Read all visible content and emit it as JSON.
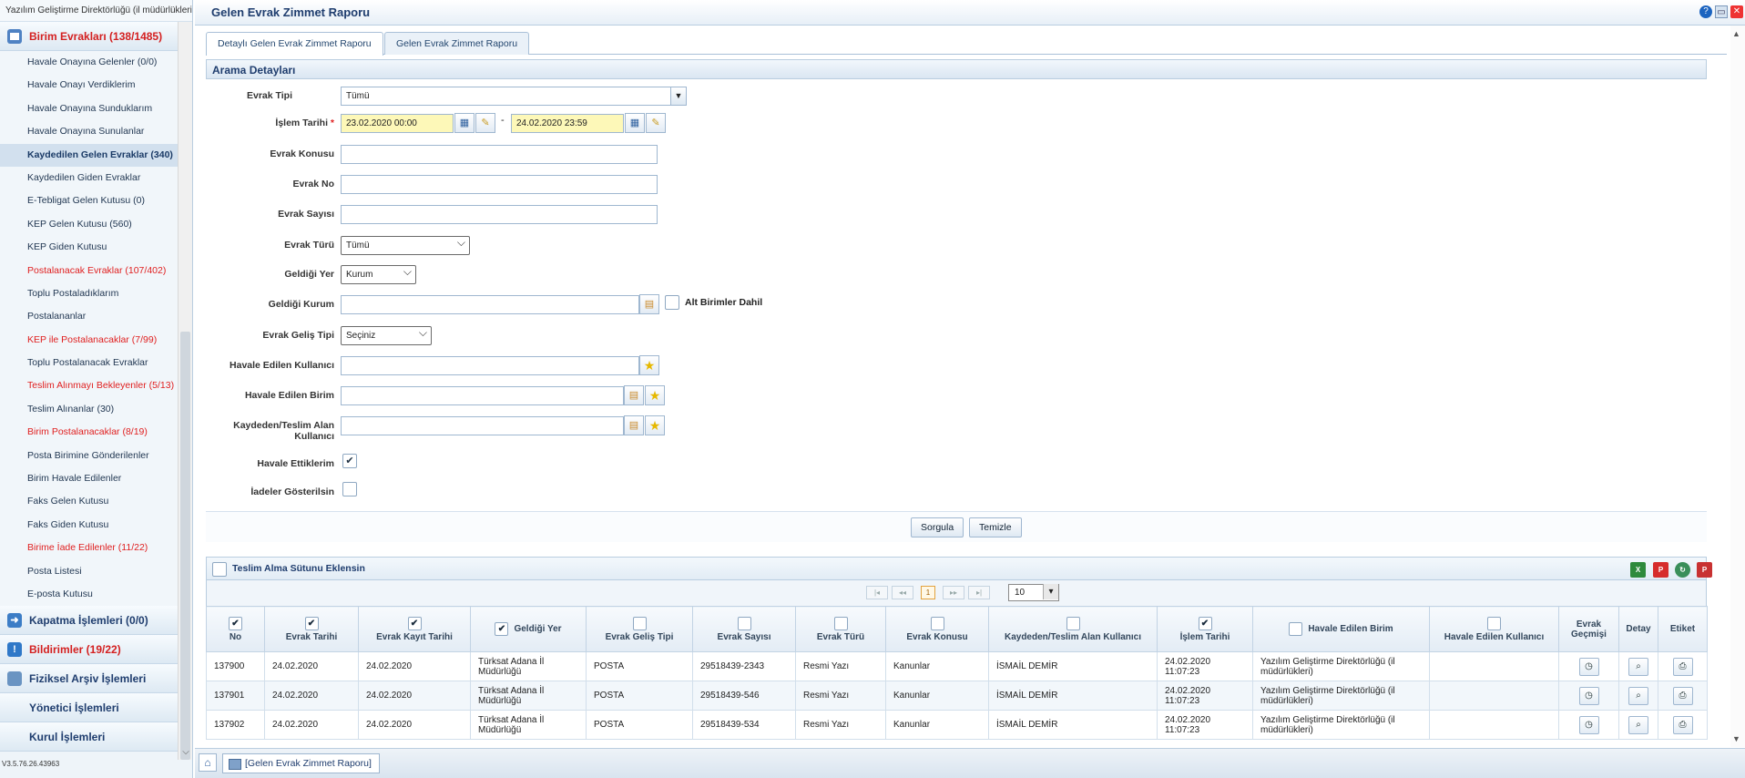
{
  "sidebar": {
    "header": "Yazılım Geliştirme Direktörlüğü (il müdürlükleri)",
    "version": "V3.5.76.26.43963",
    "section_main": "Birim Evrakları (138/1485)",
    "items": [
      {
        "label": "Havale Onayına Gelenler (0/0)",
        "red": false
      },
      {
        "label": "Havale Onayı Verdiklerim",
        "red": false
      },
      {
        "label": "Havale Onayına Sunduklarım",
        "red": false
      },
      {
        "label": "Havale Onayına Sunulanlar",
        "red": false
      },
      {
        "label": "Kaydedilen Gelen Evraklar (340)",
        "red": false,
        "active": true
      },
      {
        "label": "Kaydedilen Giden Evraklar",
        "red": false
      },
      {
        "label": "E-Tebligat Gelen Kutusu (0)",
        "red": false
      },
      {
        "label": "KEP Gelen Kutusu (560)",
        "red": false
      },
      {
        "label": "KEP Giden Kutusu",
        "red": false
      },
      {
        "label": "Postalanacak Evraklar (107/402)",
        "red": true
      },
      {
        "label": "Toplu Postaladıklarım",
        "red": false
      },
      {
        "label": "Postalananlar",
        "red": false
      },
      {
        "label": "KEP ile Postalanacaklar (7/99)",
        "red": true
      },
      {
        "label": "Toplu Postalanacak Evraklar",
        "red": false
      },
      {
        "label": "Teslim Alınmayı Bekleyenler (5/13)",
        "red": true
      },
      {
        "label": "Teslim Alınanlar (30)",
        "red": false
      },
      {
        "label": "Birim Postalanacaklar (8/19)",
        "red": true
      },
      {
        "label": "Posta Birimine Gönderilenler",
        "red": false
      },
      {
        "label": "Birim Havale Edilenler",
        "red": false
      },
      {
        "label": "Faks Gelen Kutusu",
        "red": false
      },
      {
        "label": "Faks Giden Kutusu",
        "red": false
      },
      {
        "label": "Birime İade Edilenler (11/22)",
        "red": true
      },
      {
        "label": "Posta Listesi",
        "red": false
      },
      {
        "label": "E-posta Kutusu",
        "red": false
      }
    ],
    "section_kapatma": "Kapatma İşlemleri (0/0)",
    "section_bildirimler": "Bildirimler (19/22)",
    "section_arsiv": "Fiziksel Arşiv İşlemleri",
    "section_yonetici": "Yönetici İşlemleri",
    "section_kurul": "Kurul İşlemleri"
  },
  "header": {
    "title": "Gelen Evrak Zimmet Raporu",
    "help": "?"
  },
  "tabs": [
    "Detaylı Gelen Evrak Zimmet Raporu",
    "Gelen Evrak Zimmet Raporu"
  ],
  "form": {
    "section_title": "Arama Detayları",
    "evrak_tipi_label": "Evrak Tipi",
    "evrak_tipi_value": "Tümü",
    "islem_tarihi_label": "İşlem Tarihi",
    "islem_tarihi_required": "*",
    "islem_tarihi_from": "23.02.2020 00:00",
    "islem_tarihi_sep": "-",
    "islem_tarihi_to": "24.02.2020 23:59",
    "evrak_konusu_label": "Evrak Konusu",
    "evrak_no_label": "Evrak No",
    "evrak_sayisi_label": "Evrak Sayısı",
    "evrak_turu_label": "Evrak Türü",
    "evrak_turu_value": "Tümü",
    "geldigi_yer_label": "Geldiği Yer",
    "geldigi_yer_value": "Kurum",
    "geldigi_kurum_label": "Geldiği Kurum",
    "alt_birimler_label": "Alt Birimler Dahil",
    "evrak_gelis_tipi_label": "Evrak Geliş Tipi",
    "evrak_gelis_tipi_value": "Seçiniz",
    "havale_edilen_kullanici_label": "Havale Edilen Kullanıcı",
    "havale_edilen_birim_label": "Havale Edilen Birim",
    "kaydeden_label": "Kaydeden/Teslim Alan Kullanıcı",
    "havale_ettiklerim_label": "Havale Ettiklerim",
    "iadeler_label": "İadeler Gösterilsin"
  },
  "actions": {
    "sorgula": "Sorgula",
    "temizle": "Temizle"
  },
  "grid": {
    "teslim_alma_label": "Teslim Alma Sütunu Eklensin",
    "pager_current": "1",
    "page_size": "10",
    "columns": [
      {
        "label": "No",
        "checked": true
      },
      {
        "label": "Evrak Tarihi",
        "checked": true
      },
      {
        "label": "Evrak Kayıt Tarihi",
        "checked": true
      },
      {
        "label": "Geldiği Yer",
        "checked": true,
        "inline": true
      },
      {
        "label": "Evrak Geliş Tipi",
        "checked": false
      },
      {
        "label": "Evrak Sayısı",
        "checked": false
      },
      {
        "label": "Evrak Türü",
        "checked": false
      },
      {
        "label": "Evrak Konusu",
        "checked": false
      },
      {
        "label": "Kaydeden/Teslim Alan Kullanıcı",
        "checked": false
      },
      {
        "label": "İşlem Tarihi",
        "checked": true
      },
      {
        "label": "Havale Edilen Birim",
        "checked": false,
        "inline": true
      },
      {
        "label": "Havale Edilen Kullanıcı",
        "checked": false
      },
      {
        "label": "Evrak Geçmişi",
        "nocheck": true
      },
      {
        "label": "Detay",
        "nocheck": true
      },
      {
        "label": "Etiket",
        "nocheck": true
      }
    ],
    "rows": [
      [
        "137900",
        "24.02.2020",
        "24.02.2020",
        "Türksat Adana İl Müdürlüğü",
        "POSTA",
        "29518439-2343",
        "Resmi Yazı",
        "Kanunlar",
        "İSMAİL DEMİR",
        "24.02.2020 11:07:23",
        "Yazılım Geliştirme Direktörlüğü (il müdürlükleri)",
        ""
      ],
      [
        "137901",
        "24.02.2020",
        "24.02.2020",
        "Türksat Adana İl Müdürlüğü",
        "POSTA",
        "29518439-546",
        "Resmi Yazı",
        "Kanunlar",
        "İSMAİL DEMİR",
        "24.02.2020 11:07:23",
        "Yazılım Geliştirme Direktörlüğü (il müdürlükleri)",
        ""
      ],
      [
        "137902",
        "24.02.2020",
        "24.02.2020",
        "Türksat Adana İl Müdürlüğü",
        "POSTA",
        "29518439-534",
        "Resmi Yazı",
        "Kanunlar",
        "İSMAİL DEMİR",
        "24.02.2020 11:07:23",
        "Yazılım Geliştirme Direktörlüğü (il müdürlükleri)",
        ""
      ]
    ]
  },
  "taskbar": {
    "task_label": "[Gelen Evrak Zimmet Raporu]"
  }
}
